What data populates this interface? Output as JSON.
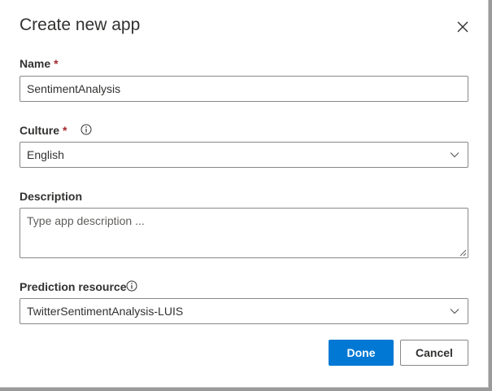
{
  "dialog": {
    "title": "Create new app",
    "close_icon": "close-icon"
  },
  "name": {
    "label": "Name",
    "required_mark": "*",
    "value": "SentimentAnalysis"
  },
  "culture": {
    "label": "Culture",
    "required_mark": "*",
    "info_icon": "info-icon",
    "selected": "English",
    "dropdown_icon": "chevron-down-icon"
  },
  "description": {
    "label": "Description",
    "placeholder": "Type app description ..."
  },
  "prediction": {
    "label": "Prediction resource",
    "info_icon": "info-icon",
    "selected": "TwitterSentimentAnalysis-LUIS",
    "dropdown_icon": "chevron-down-icon"
  },
  "actions": {
    "done_label": "Done",
    "cancel_label": "Cancel"
  },
  "colors": {
    "primary": "#0078d4",
    "required": "#a4262c",
    "text": "#323130",
    "border": "#8a8886"
  }
}
